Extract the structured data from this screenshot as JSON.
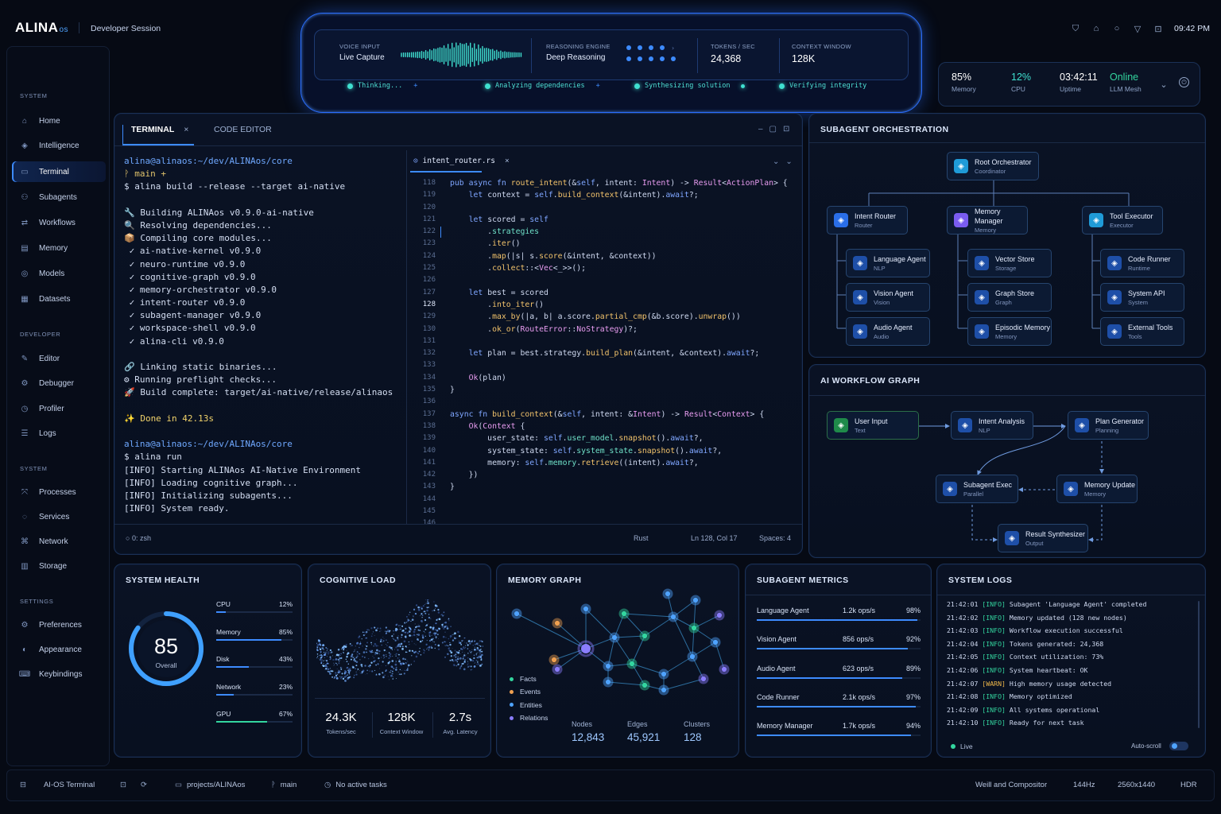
{
  "app": {
    "logo": "ALINA",
    "logo_suffix": "os",
    "session": "Developer Session",
    "clock": "09:42 PM"
  },
  "topbar_icons": [
    "shield-icon",
    "bell-icon",
    "circle-icon",
    "mail-icon",
    "lock-icon"
  ],
  "hud": {
    "voice_label": "VOICE INPUT",
    "voice_value": "Live Capture",
    "reason_label": "REASONING ENGINE",
    "reason_value": "Deep Reasoning",
    "tokens_label": "TOKENS / SEC",
    "tokens_value": "24,368",
    "context_label": "CONTEXT WINDOW",
    "context_value": "128K",
    "stages": [
      "Thinking...",
      "Analyzing dependencies",
      "Synthesizing solution",
      "Verifying integrity"
    ]
  },
  "stats": [
    {
      "value": "85%",
      "label": "Memory"
    },
    {
      "value": "12%",
      "label": "CPU"
    },
    {
      "value": "03:42:11",
      "label": "Uptime"
    },
    {
      "value": "Online",
      "label": "LLM Mesh"
    }
  ],
  "sidebar": {
    "sections": [
      {
        "title": "SYSTEM",
        "items": [
          {
            "label": "Home",
            "icon": "home-icon"
          },
          {
            "label": "Intelligence",
            "icon": "brain-icon"
          },
          {
            "label": "Terminal",
            "icon": "terminal-icon",
            "active": true
          },
          {
            "label": "Subagents",
            "icon": "agents-icon"
          },
          {
            "label": "Workflows",
            "icon": "workflow-icon"
          },
          {
            "label": "Memory",
            "icon": "memory-icon"
          },
          {
            "label": "Models",
            "icon": "models-icon"
          },
          {
            "label": "Datasets",
            "icon": "database-icon"
          }
        ]
      },
      {
        "title": "DEVELOPER",
        "items": [
          {
            "label": "Editor",
            "icon": "edit-icon"
          },
          {
            "label": "Debugger",
            "icon": "bug-icon"
          },
          {
            "label": "Profiler",
            "icon": "profiler-icon"
          },
          {
            "label": "Logs",
            "icon": "list-icon"
          }
        ]
      },
      {
        "title": "SYSTEM",
        "items": [
          {
            "label": "Processes",
            "icon": "process-icon"
          },
          {
            "label": "Services",
            "icon": "services-icon"
          },
          {
            "label": "Network",
            "icon": "network-icon"
          },
          {
            "label": "Storage",
            "icon": "storage-icon"
          }
        ]
      },
      {
        "title": "SETTINGS",
        "items": [
          {
            "label": "Preferences",
            "icon": "gear-icon"
          },
          {
            "label": "Appearance",
            "icon": "palette-icon"
          },
          {
            "label": "Keybindings",
            "icon": "keyboard-icon"
          }
        ]
      }
    ]
  },
  "terminal": {
    "tab_terminal": "TERMINAL",
    "tab_editor": "CODE EDITOR",
    "lines": [
      "alina@alinaos:~/dev/ALINAos/core",
      "ᚹ main +",
      "$ alina build --release --target ai-native",
      "",
      "🔧 Building ALINAos v0.9.0-ai-native",
      "🔍 Resolving dependencies...",
      "📦 Compiling core modules...",
      " ✓ ai-native-kernel v0.9.0",
      " ✓ neuro-runtime v0.9.0",
      " ✓ cognitive-graph v0.9.0",
      " ✓ memory-orchestrator v0.9.0",
      " ✓ intent-router v0.9.0",
      " ✓ subagent-manager v0.9.0",
      " ✓ workspace-shell v0.9.0",
      " ✓ alina-cli v0.9.0",
      "",
      "🔗 Linking static binaries...",
      "⚙ Running preflight checks...",
      "🚀 Build complete: target/ai-native/release/alinaos",
      "",
      "✨ Done in 42.13s",
      "",
      "alina@alinaos:~/dev/ALINAos/core",
      "$ alina run",
      "[INFO] Starting ALINAos AI-Native Environment",
      "[INFO] Loading cognitive graph...",
      "[INFO] Initializing subagents...",
      "[INFO] System ready."
    ],
    "shell": "0: zsh"
  },
  "editor": {
    "file": "intent_router.rs",
    "line_numbers": [
      "118",
      "119",
      "120",
      "121",
      "122",
      "123",
      "124",
      "125",
      "126",
      "127",
      "128",
      "129",
      "130",
      "131",
      "132",
      "133",
      "134",
      "135",
      "136",
      "137",
      "138",
      "139",
      "140",
      "141",
      "142",
      "143",
      "144",
      "145",
      "146"
    ],
    "language": "Rust",
    "cursor": "Ln 128, Col 17",
    "spaces": "Spaces: 4"
  },
  "orchestration": {
    "title": "SUBAGENT ORCHESTRATION",
    "root": {
      "title": "Root Orchestrator",
      "sub": "Coordinator"
    },
    "columns": [
      {
        "title": "Intent Router",
        "sub": "Router",
        "children": [
          {
            "title": "Language Agent",
            "sub": "NLP"
          },
          {
            "title": "Vision Agent",
            "sub": "Vision"
          },
          {
            "title": "Audio Agent",
            "sub": "Audio"
          }
        ]
      },
      {
        "title": "Memory Manager",
        "sub": "Memory",
        "children": [
          {
            "title": "Vector Store",
            "sub": "Storage"
          },
          {
            "title": "Graph Store",
            "sub": "Graph"
          },
          {
            "title": "Episodic Memory",
            "sub": "Memory"
          }
        ]
      },
      {
        "title": "Tool Executor",
        "sub": "Executor",
        "children": [
          {
            "title": "Code Runner",
            "sub": "Runtime"
          },
          {
            "title": "System API",
            "sub": "System"
          },
          {
            "title": "External Tools",
            "sub": "Tools"
          }
        ]
      }
    ]
  },
  "workflow": {
    "title": "AI WORKFLOW GRAPH",
    "nodes": [
      {
        "title": "User Input",
        "sub": "Text"
      },
      {
        "title": "Intent Analysis",
        "sub": "NLP"
      },
      {
        "title": "Plan Generator",
        "sub": "Planning"
      },
      {
        "title": "Subagent Exec",
        "sub": "Parallel"
      },
      {
        "title": "Memory Update",
        "sub": "Memory"
      },
      {
        "title": "Result Synthesizer",
        "sub": "Output"
      }
    ]
  },
  "health": {
    "title": "SYSTEM HEALTH",
    "overall": "85",
    "overall_label": "Overall",
    "overall_fraction": 0.85,
    "rows": [
      {
        "label": "CPU",
        "pct": "12%",
        "v": 0.12
      },
      {
        "label": "Memory",
        "pct": "85%",
        "v": 0.85
      },
      {
        "label": "Disk",
        "pct": "43%",
        "v": 0.43
      },
      {
        "label": "Network",
        "pct": "23%",
        "v": 0.23
      },
      {
        "label": "GPU",
        "pct": "67%",
        "v": 0.67
      }
    ]
  },
  "cognitive": {
    "title": "COGNITIVE LOAD",
    "stats": [
      {
        "value": "24.3K",
        "label": "Tokens/sec"
      },
      {
        "value": "128K",
        "label": "Context Window"
      },
      {
        "value": "2.7s",
        "label": "Avg. Latency"
      }
    ]
  },
  "memory_graph": {
    "title": "MEMORY GRAPH",
    "legend": [
      {
        "label": "Facts",
        "color": "#33d69f"
      },
      {
        "label": "Events",
        "color": "#f0a050"
      },
      {
        "label": "Entities",
        "color": "#4fa3ff"
      },
      {
        "label": "Relations",
        "color": "#8b7dff"
      }
    ],
    "stats": [
      {
        "label": "Nodes",
        "value": "12,843"
      },
      {
        "label": "Edges",
        "value": "45,921"
      },
      {
        "label": "Clusters",
        "value": "128"
      }
    ]
  },
  "metrics": {
    "title": "SUBAGENT METRICS",
    "rows": [
      {
        "name": "Language Agent",
        "ops": "1.2k ops/s",
        "pct": "98%",
        "v": 0.98
      },
      {
        "name": "Vision Agent",
        "ops": "856 ops/s",
        "pct": "92%",
        "v": 0.92
      },
      {
        "name": "Audio Agent",
        "ops": "623 ops/s",
        "pct": "89%",
        "v": 0.89
      },
      {
        "name": "Code Runner",
        "ops": "2.1k ops/s",
        "pct": "97%",
        "v": 0.97
      },
      {
        "name": "Memory Manager",
        "ops": "1.7k ops/s",
        "pct": "94%",
        "v": 0.94
      }
    ]
  },
  "logs": {
    "title": "SYSTEM LOGS",
    "lines": [
      {
        "t": "21:42:01",
        "lvl": "[INFO]",
        "msg": "Subagent 'Language Agent' completed"
      },
      {
        "t": "21:42:02",
        "lvl": "[INFO]",
        "msg": "Memory updated (128 new nodes)"
      },
      {
        "t": "21:42:03",
        "lvl": "[INFO]",
        "msg": "Workflow execution successful"
      },
      {
        "t": "21:42:04",
        "lvl": "[INFO]",
        "msg": "Tokens generated: 24,368"
      },
      {
        "t": "21:42:05",
        "lvl": "[INFO]",
        "msg": "Context utilization: 73%"
      },
      {
        "t": "21:42:06",
        "lvl": "[INFO]",
        "msg": "System heartbeat: OK"
      },
      {
        "t": "21:42:07",
        "lvl": "[WARN]",
        "msg": "High memory usage detected"
      },
      {
        "t": "21:42:08",
        "lvl": "[INFO]",
        "msg": "Memory optimized"
      },
      {
        "t": "21:42:09",
        "lvl": "[INFO]",
        "msg": "All systems operational"
      },
      {
        "t": "21:42:10",
        "lvl": "[INFO]",
        "msg": "Ready for next task"
      }
    ],
    "live": "Live",
    "autoscroll": "Auto-scroll"
  },
  "bottombar": {
    "terminal": "AI-OS Terminal",
    "project": "projects/ALINAos",
    "branch": "main",
    "tasks": "No active tasks",
    "compositor": "Weill and Compositor",
    "refresh": "144Hz",
    "resolution": "2560x1440",
    "hdr": "HDR"
  },
  "colors": {
    "accent": "#3d8bff",
    "cyan": "#3fe0d0",
    "green": "#33d69f",
    "warn": "#f0b84a",
    "bg": "#060a14"
  }
}
